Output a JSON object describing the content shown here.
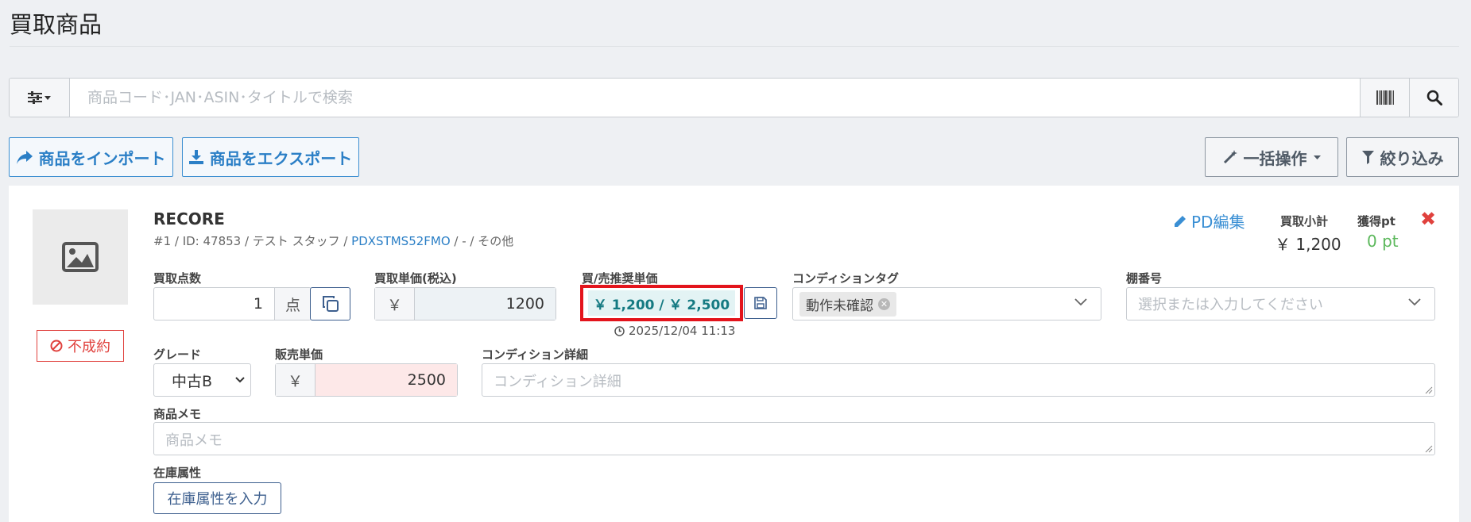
{
  "page": {
    "title": "買取商品"
  },
  "search": {
    "placeholder": "商品コード･JAN･ASIN･タイトルで検索",
    "icons": {
      "filter": "sliders-icon",
      "barcode": "barcode-icon",
      "search": "search-icon"
    }
  },
  "toolbar": {
    "import_label": "商品をインポート",
    "export_label": "商品をエクスポート",
    "bulk_label": "一括操作",
    "filter_label": "絞り込み"
  },
  "item": {
    "status_label": "不成約",
    "name": "RECORE",
    "meta_prefix": "#1 / ID: 47853 / テスト スタッフ / ",
    "meta_code": "PDXSTMS52FMO",
    "meta_suffix": " / - / その他",
    "pd_edit_label": "PD編集",
    "subtotal_label": "買取小計",
    "subtotal_value": "￥ 1,200",
    "points_label": "獲得pt",
    "points_value": "0 pt",
    "quantity": {
      "label": "買取点数",
      "value": "1",
      "unit": "点"
    },
    "unit_price": {
      "label": "買取単価(税込)",
      "currency": "￥",
      "value": "1200"
    },
    "recommended": {
      "label": "買/売推奨単価",
      "value": "￥ 1,200 / ￥ 2,500",
      "timestamp": "2025/12/04 11:13"
    },
    "condition_tag": {
      "label": "コンディションタグ",
      "tag": "動作未確認"
    },
    "shelf": {
      "label": "棚番号",
      "placeholder": "選択または入力してください"
    },
    "grade": {
      "label": "グレード",
      "value": "中古B"
    },
    "sale_price": {
      "label": "販売単価",
      "currency": "￥",
      "value": "2500"
    },
    "condition_detail": {
      "label": "コンディション詳細",
      "placeholder": "コンディション詳細"
    },
    "memo": {
      "label": "商品メモ",
      "placeholder": "商品メモ"
    },
    "inventory": {
      "label": "在庫属性",
      "button_label": "在庫属性を入力"
    }
  },
  "colors": {
    "accent_blue": "#2b7fc6",
    "danger_red": "#e0413d",
    "highlight_box": "#e3141c",
    "teal_text": "#157a82",
    "points_green": "#5cb85c",
    "sale_bg": "#fde8e8"
  }
}
